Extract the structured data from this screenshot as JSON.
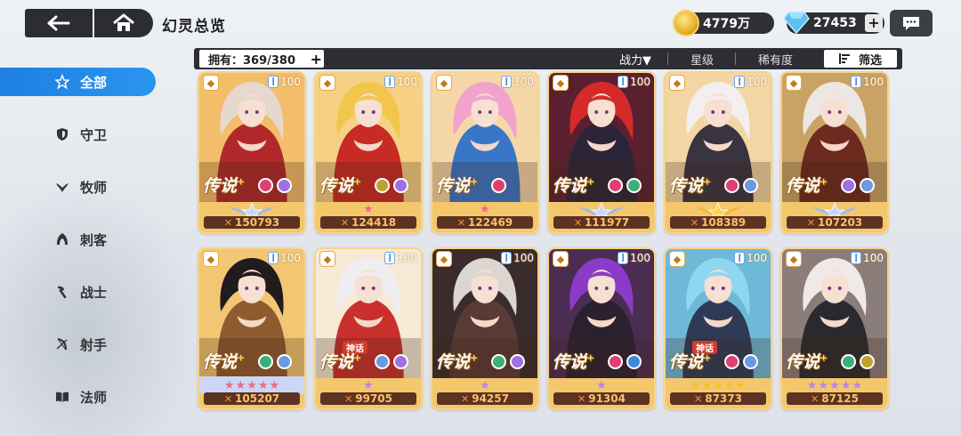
{
  "header": {
    "title": "幻灵总览",
    "gold": "4779万",
    "gems": "27453",
    "add": "+"
  },
  "filterbar": {
    "owned": "拥有：369/380",
    "owned_add": "+",
    "sort_power": "战力▼",
    "sort_star": "星级",
    "sort_rarity": "稀有度",
    "filter": "筛选"
  },
  "sidebar": [
    {
      "label": "全部",
      "icon": "star-outline-icon",
      "active": true
    },
    {
      "label": "守卫",
      "icon": "shield-icon",
      "active": false
    },
    {
      "label": "牧师",
      "icon": "wing-icon",
      "active": false
    },
    {
      "label": "刺客",
      "icon": "hood-icon",
      "active": false
    },
    {
      "label": "战士",
      "icon": "axe-icon",
      "active": false
    },
    {
      "label": "射手",
      "icon": "bow-icon",
      "active": false
    },
    {
      "label": "法师",
      "icon": "book-icon",
      "active": false
    }
  ],
  "cards": [
    {
      "rank": "传说",
      "level": "100",
      "power": "150793",
      "myth": "",
      "stars": "wings",
      "hair": "#e6d8cf",
      "outfit": "#b0282a",
      "bg": "#f3bd6a",
      "elems": [
        "#e04070",
        "#a070e0"
      ]
    },
    {
      "rank": "传说",
      "level": "100",
      "power": "124418",
      "myth": "",
      "stars": "1-pink",
      "hair": "#f2c64a",
      "outfit": "#c82b24",
      "bg": "#f6d185",
      "elems": [
        "#c0a030",
        "#a070e0"
      ]
    },
    {
      "rank": "传说",
      "level": "100",
      "power": "122469",
      "myth": "",
      "stars": "1-pink",
      "hair": "#f1a3cc",
      "outfit": "#3a76c8",
      "bg": "#f6d7a8",
      "elems": [
        "#e04070"
      ]
    },
    {
      "rank": "传说",
      "level": "100",
      "power": "111977",
      "myth": "",
      "stars": "wings",
      "hair": "#d52a2a",
      "outfit": "#2c2438",
      "bg": "#5a2030",
      "elems": [
        "#e04070",
        "#3cb07a"
      ]
    },
    {
      "rank": "传说",
      "level": "100",
      "power": "108389",
      "myth": "",
      "stars": "wings-gold",
      "hair": "#f3efee",
      "outfit": "#3a3340",
      "bg": "#f3d6a3",
      "elems": [
        "#e04070",
        "#6a9ae0"
      ]
    },
    {
      "rank": "传说",
      "level": "100",
      "power": "107203",
      "myth": "",
      "stars": "wings",
      "hair": "#ece7e2",
      "outfit": "#6d2a1e",
      "bg": "#c9a266",
      "elems": [
        "#a070e0",
        "#6a9ae0"
      ]
    },
    {
      "rank": "传说",
      "level": "100",
      "power": "105207",
      "myth": "",
      "stars": "5-pink",
      "hair": "#211b1e",
      "outfit": "#8f5a2e",
      "bg": "#f2c673",
      "elems": [
        "#3cb07a",
        "#6a9ae0"
      ]
    },
    {
      "rank": "传说",
      "level": "100",
      "power": "99705",
      "myth": "神话",
      "stars": "1-purple",
      "hair": "#eeeef2",
      "outfit": "#c9302c",
      "bg": "#f6ead6",
      "elems": [
        "#6a9ae0",
        "#a070e0"
      ]
    },
    {
      "rank": "传说",
      "level": "100",
      "power": "94257",
      "myth": "",
      "stars": "1-purple",
      "hair": "#dcd6d0",
      "outfit": "#5a3a36",
      "bg": "#3a2c2c",
      "elems": [
        "#3cb07a",
        "#a070e0"
      ]
    },
    {
      "rank": "传说",
      "level": "100",
      "power": "91304",
      "myth": "",
      "stars": "1-purple",
      "hair": "#8a3cc8",
      "outfit": "#2a2030",
      "bg": "#4c2d52",
      "elems": [
        "#e04070",
        "#3a8ad8"
      ]
    },
    {
      "rank": "传说",
      "level": "100",
      "power": "87373",
      "myth": "神话",
      "stars": "5-gold",
      "hair": "#8fd6f0",
      "outfit": "#2e3b56",
      "bg": "#6fb9d8",
      "elems": [
        "#e04070",
        "#6a9ae0"
      ]
    },
    {
      "rank": "传说",
      "level": "100",
      "power": "87125",
      "myth": "",
      "stars": "5-purple",
      "hair": "#efe9ea",
      "outfit": "#2a2a2e",
      "bg": "#8b7e7a",
      "elems": [
        "#3cb07a",
        "#c0a030"
      ]
    }
  ]
}
